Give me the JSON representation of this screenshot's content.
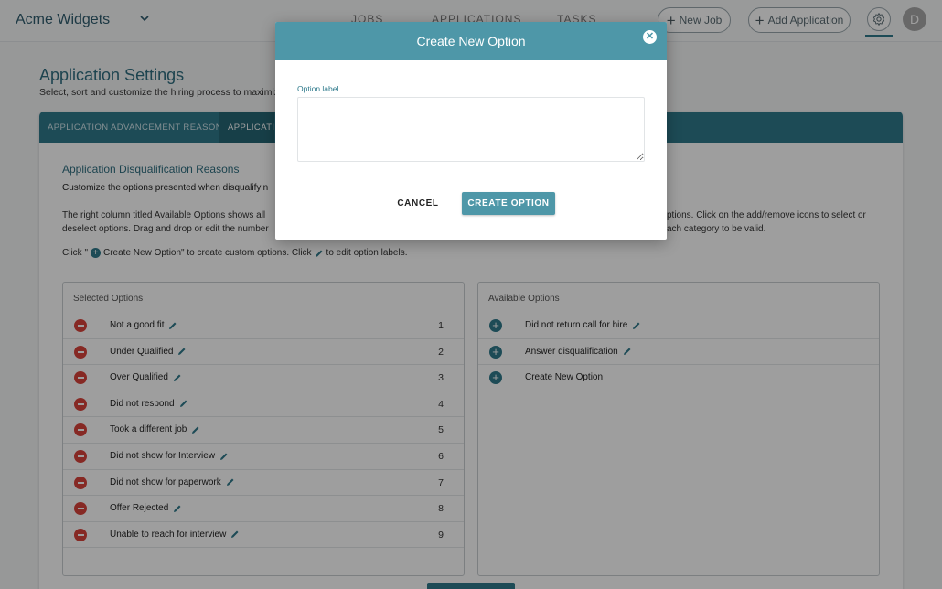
{
  "app": {
    "brand": "Acme Widgets",
    "avatar_initial": "D"
  },
  "nav": {
    "jobs": "JOBS",
    "applications": "APPLICATIONS",
    "tasks": "TASKS"
  },
  "actions": {
    "new_job": "New Job",
    "add_application": "Add Application"
  },
  "page": {
    "title": "Application Settings",
    "subtitle": "Select, sort and customize the hiring process to maximiz"
  },
  "tabs": [
    {
      "label": "APPLICATION ADVANCEMENT REASONS"
    },
    {
      "label": "APPLICATI"
    }
  ],
  "section": {
    "title": "Application Disqualification Reasons",
    "description": "Customize the options presented when disqualifyin",
    "para_left_1": "The right column titled Available Options shows all",
    "para_left_2": "deselect options. Drag and drop or edit the number",
    "para_right_1": "ptions. Click on the add/remove icons to select or",
    "para_right_2": "ach category to be valid.",
    "click_prefix": "Click \"",
    "click_middle": "Create New Option\" to create custom options. Click",
    "click_suffix": "to edit option labels."
  },
  "selected_panel": {
    "title": "Selected Options",
    "items": [
      {
        "label": "Not a good fit",
        "order": "1"
      },
      {
        "label": "Under Qualified",
        "order": "2"
      },
      {
        "label": "Over Qualified",
        "order": "3"
      },
      {
        "label": "Did not respond",
        "order": "4"
      },
      {
        "label": "Took a different job",
        "order": "5"
      },
      {
        "label": "Did not show for Interview",
        "order": "6"
      },
      {
        "label": "Did not show for paperwork",
        "order": "7"
      },
      {
        "label": "Offer Rejected",
        "order": "8"
      },
      {
        "label": "Unable to reach for interview",
        "order": "9"
      }
    ]
  },
  "available_panel": {
    "title": "Available Options",
    "items": [
      {
        "label": "Did not return call for hire"
      },
      {
        "label": "Answer disqualification"
      },
      {
        "label": "Create New Option"
      }
    ]
  },
  "modal": {
    "title": "Create New Option",
    "field_label": "Option label",
    "field_value": "",
    "cancel_label": "CANCEL",
    "create_label": "CREATE OPTION"
  },
  "colors": {
    "primary": "#2f7a8c",
    "modal_header": "#4e97a8",
    "remove": "#d9433b"
  }
}
